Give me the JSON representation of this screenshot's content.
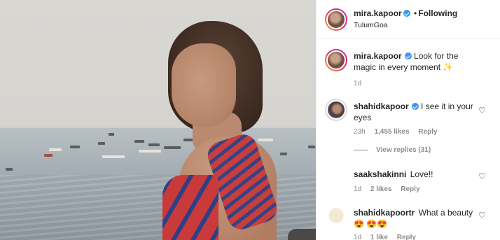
{
  "post": {
    "image_alt_icon": "photo-content"
  },
  "header": {
    "username": "mira.kapoor",
    "follow_state": "Following",
    "separator": "•",
    "location": "TulumGoa"
  },
  "caption": {
    "username": "mira.kapoor",
    "text": "Look for the magic in every moment ✨",
    "time": "1d"
  },
  "comments": [
    {
      "username": "shahidkapoor",
      "verified": true,
      "text": "I see it in your eyes",
      "time": "23h",
      "likes": "1,455 likes",
      "reply": "Reply",
      "view_replies": "View replies (31)"
    },
    {
      "username": "saakshakinni",
      "verified": false,
      "text": "Love!!",
      "time": "1d",
      "likes": "2 likes",
      "reply": "Reply"
    },
    {
      "username": "shahidkapoortr",
      "verified": false,
      "text": "What a beauty 😍 😍😍",
      "time": "1d",
      "likes": "1 like",
      "reply": "Reply"
    }
  ],
  "colors": {
    "link_blue": "#3897f0",
    "muted": "#8e8e8e",
    "text": "#262626"
  }
}
